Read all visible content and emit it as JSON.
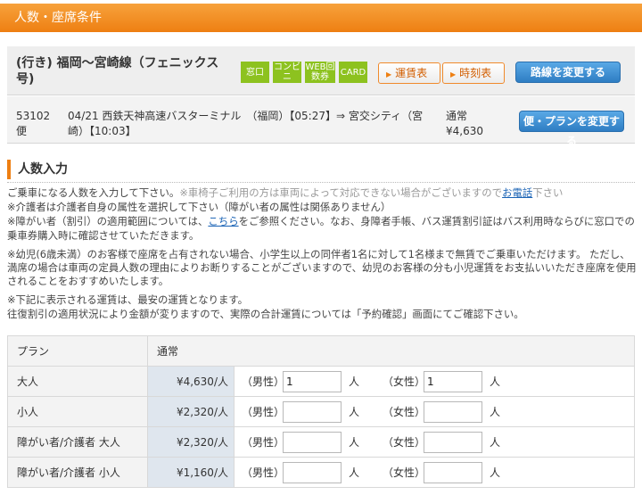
{
  "header": {
    "title": "人数・座席条件"
  },
  "route": {
    "name": "(行き) 福岡～宮崎線（フェニックス号)",
    "tags": [
      "窓口",
      "コンビニ",
      "WEB回数券",
      "CARD"
    ],
    "fare_button": "運賃表",
    "timetable_button": "時刻表",
    "change_route_button": "路線を変更する"
  },
  "schedule": {
    "bus_no": "53102便",
    "detail": "04/21 西鉄天神高速バスターミナル　（福岡）【05:27】⇒ 宮交シティ（宮崎）【10:03】",
    "fare_type": "通常",
    "fare": "¥4,630",
    "change_plan_button": "便・プランを変更する"
  },
  "section": {
    "title": "人数入力"
  },
  "notes": {
    "n1_a": "ご乗車になる人数を入力して下さい。",
    "n1_b": "※車椅子ご利用の方は車両によって対応できない場合がございますので",
    "n1_link": "お電話",
    "n1_c": "下さい",
    "n2": "※介護者は介護者自身の属性を選択して下さい（障がい者の属性は関係ありません）",
    "n3_a": "※障がい者（割引）の適用範囲については、",
    "n3_link": "こちら",
    "n3_b": "をご参照ください。なお、身障者手帳、バス運賃割引証はバス利用時ならびに窓口での乗車券購入時に確認させていただきます。",
    "n4": "※幼児(6歳未満）のお客様で座席を占有されない場合、小学生以上の同伴者1名に対して1名様まで無賃でご乗車いただけます。 ただし、満席の場合は車両の定員人数の理由によりお断りすることがございますので、幼児のお客様の分も小児運賃をお支払いいただき座席を使用されることをおすすめいたします。",
    "n5": "※下記に表示される運賃は、最安の運賃となります。",
    "n6": "往復割引の適用状況により金額が変りますので、実際の合計運賃については「予約確認」画面にてご確認下さい。"
  },
  "table": {
    "col_plan": "プラン",
    "col_fare_type": "通常",
    "male": "（男性）",
    "female": "（女性）",
    "unit": "人",
    "rows": [
      {
        "label": "大人",
        "price": "¥4,630/人",
        "male_value": "1",
        "female_value": "1"
      },
      {
        "label": "小人",
        "price": "¥2,320/人",
        "male_value": "",
        "female_value": ""
      },
      {
        "label": "障がい者/介護者 大人",
        "price": "¥2,320/人",
        "male_value": "",
        "female_value": ""
      },
      {
        "label": "障がい者/介護者 小人",
        "price": "¥1,160/人",
        "male_value": "",
        "female_value": ""
      }
    ]
  },
  "colors": {
    "accent": "#ee7f12",
    "tag_green": "#8dc21f",
    "button_blue": "#2e7dc3"
  }
}
